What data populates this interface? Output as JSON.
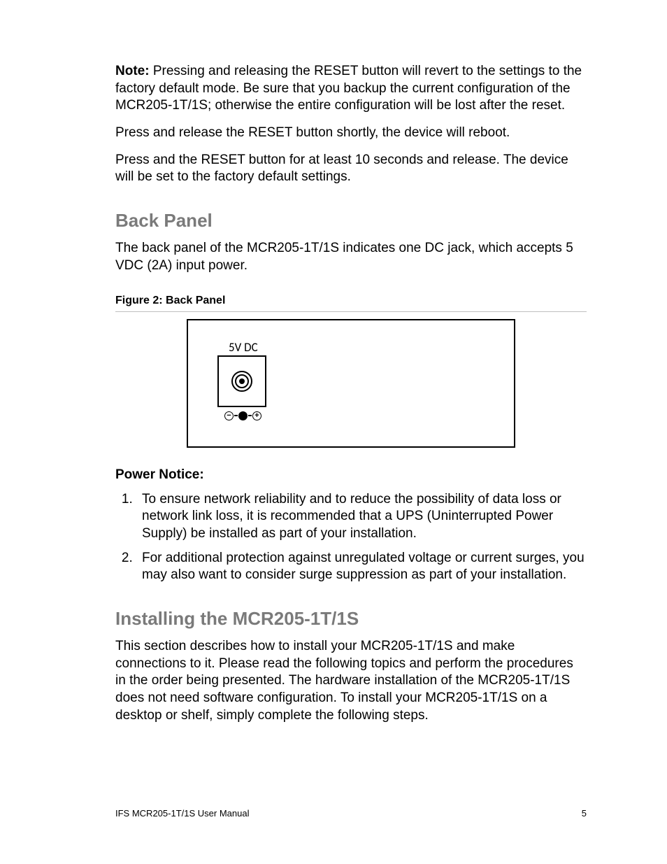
{
  "paragraphs": {
    "note_label": "Note:",
    "note_body": " Pressing and releasing the RESET button will revert to the settings to the factory default mode. Be sure that you backup the current configuration of the MCR205-1T/1S; otherwise the entire configuration will be lost after the reset.",
    "p2": "Press and release the RESET button shortly, the device will reboot.",
    "p3": "Press and the RESET button for at least 10 seconds and release. The device will be set to the factory default settings."
  },
  "sections": {
    "back_panel": {
      "heading": "Back Panel",
      "intro": "The back panel of the MCR205-1T/1S indicates one DC jack, which accepts 5 VDC (2A) input power.",
      "figure_caption": "Figure 2: Back Panel",
      "panel_label": "5V DC",
      "power_notice_heading": "Power Notice:",
      "notice_items": [
        "To ensure network reliability and to reduce the possibility of data loss or network link loss, it is recommended that a UPS (Uninterrupted Power Supply) be installed as part of your installation.",
        "For additional protection against unregulated voltage or current surges, you may also want to consider surge suppression as part of your installation."
      ]
    },
    "installing": {
      "heading": "Installing the MCR205-1T/1S",
      "intro": "This section describes how to install your MCR205-1T/1S and make connections to it. Please read the following topics and perform the procedures in the order being presented. The hardware installation of the MCR205-1T/1S does not need software configuration. To install your MCR205-1T/1S on a desktop or shelf, simply complete the following steps."
    }
  },
  "footer": {
    "left": "IFS MCR205-1T/1S User Manual",
    "right": "5"
  }
}
